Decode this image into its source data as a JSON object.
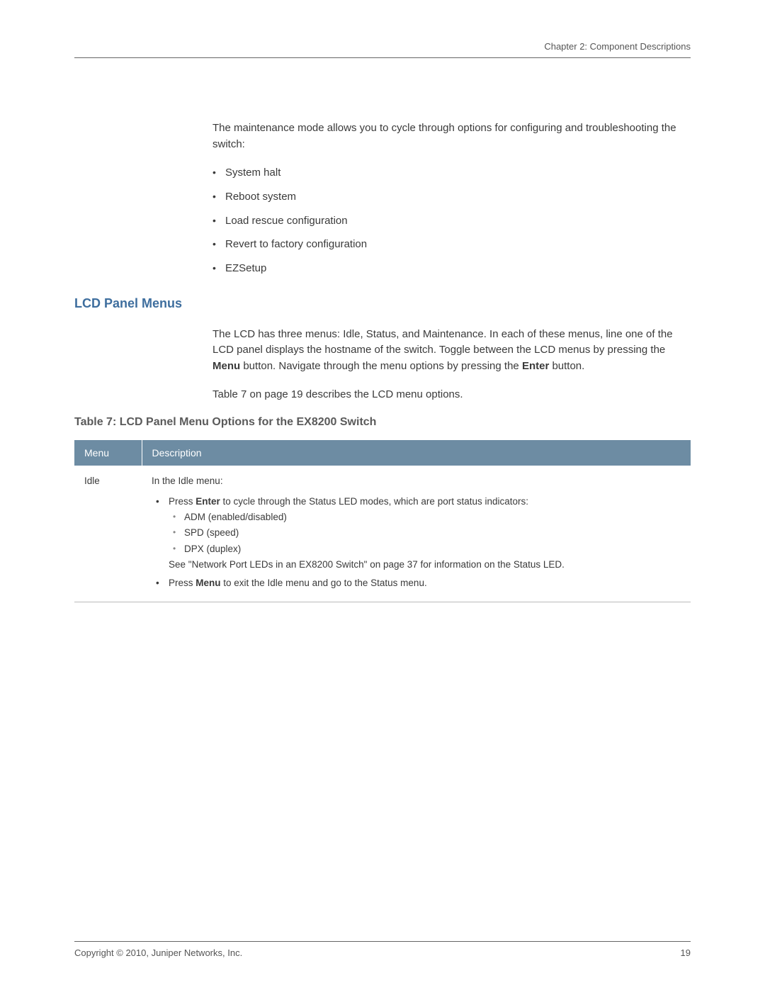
{
  "header": {
    "chapter": "Chapter 2: Component Descriptions"
  },
  "intro": {
    "paragraph": "The maintenance mode allows you to cycle through options for configuring and troubleshooting the switch:",
    "bullets": [
      "System halt",
      "Reboot system",
      "Load rescue configuration",
      "Revert to factory configuration",
      "EZSetup"
    ]
  },
  "section": {
    "heading": "LCD Panel Menus",
    "para1_a": "The LCD has three menus: Idle, Status, and Maintenance. In each of these menus, line one of the LCD panel displays the hostname of the switch. Toggle between the LCD menus by pressing the ",
    "para1_menu": "Menu",
    "para1_b": " button. Navigate through the menu options by pressing the ",
    "para1_enter": "Enter",
    "para1_c": " button.",
    "para2": "Table 7 on page 19 describes the LCD menu options."
  },
  "table": {
    "title": "Table 7: LCD Panel Menu Options for the EX8200 Switch",
    "header_menu": "Menu",
    "header_description": "Description",
    "row1": {
      "menu": "Idle",
      "desc_intro": "In the Idle menu:",
      "bullet1_a": "Press ",
      "bullet1_enter": "Enter",
      "bullet1_b": " to cycle through the Status LED modes, which are port status indicators:",
      "sub1": "ADM (enabled/disabled)",
      "sub2": "SPD (speed)",
      "sub3": "DPX (duplex)",
      "see": "See \"Network Port LEDs in an EX8200 Switch\" on page 37 for information on the Status LED.",
      "bullet2_a": "Press ",
      "bullet2_menu": "Menu",
      "bullet2_b": " to exit the Idle menu and go to the Status menu."
    }
  },
  "footer": {
    "copyright": "Copyright © 2010, Juniper Networks, Inc.",
    "page": "19"
  }
}
